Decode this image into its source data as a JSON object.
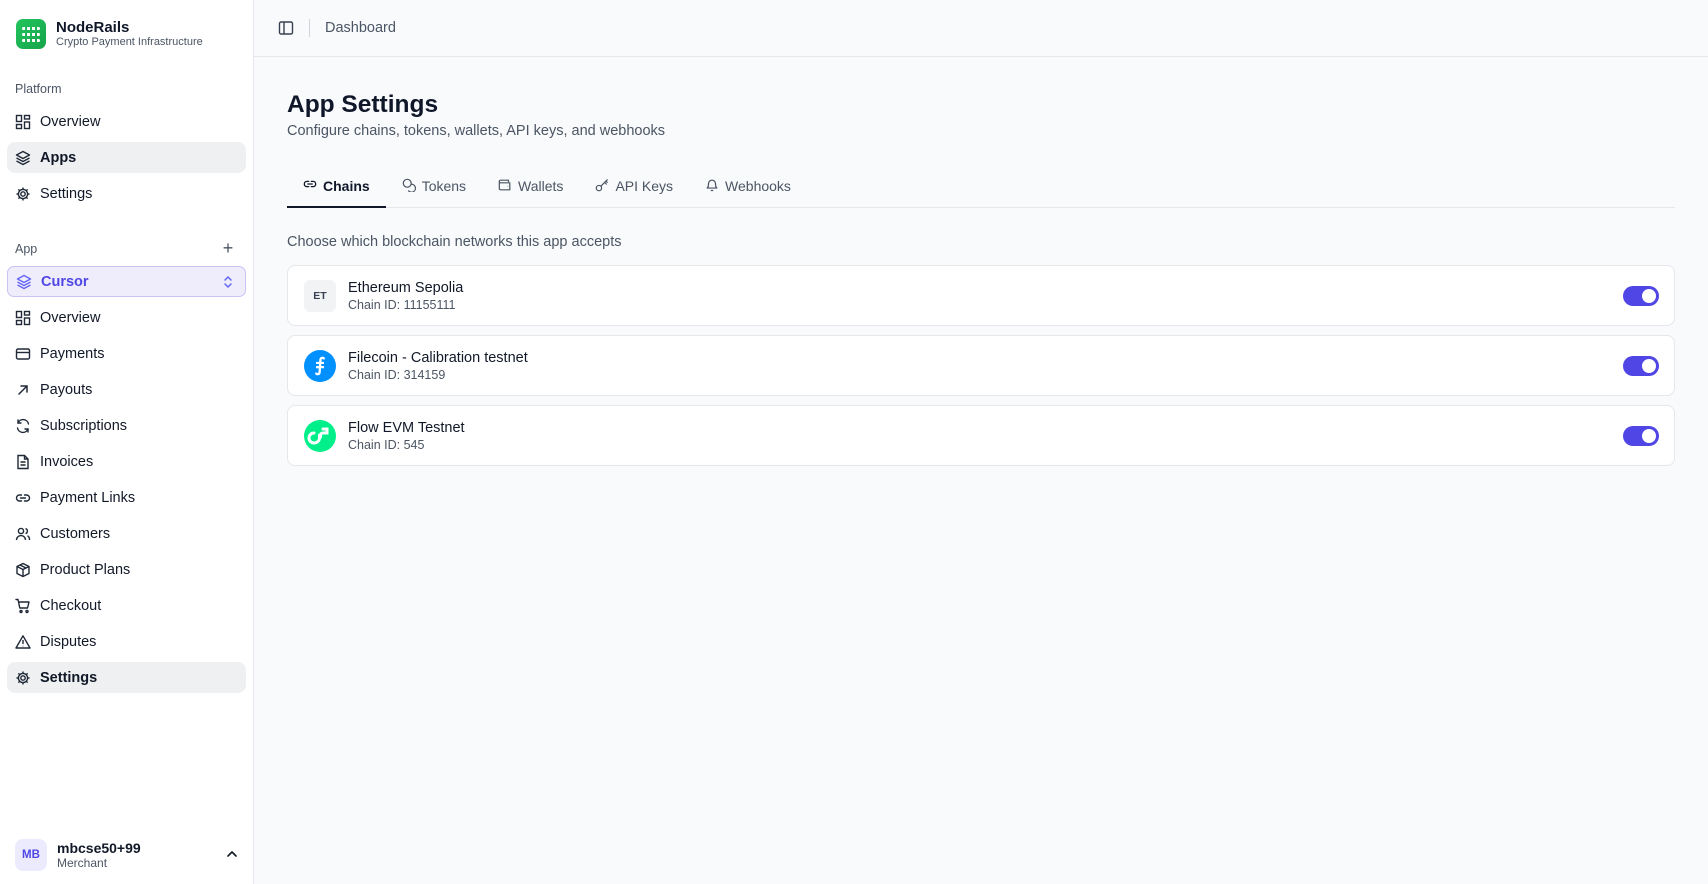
{
  "brand": {
    "name": "NodeRails",
    "tagline": "Crypto Payment Infrastructure"
  },
  "sidebar": {
    "platform_label": "Platform",
    "platform_items": [
      {
        "label": "Overview",
        "icon": "dashboard-icon"
      },
      {
        "label": "Apps",
        "icon": "layers-icon",
        "active": true
      },
      {
        "label": "Settings",
        "icon": "gear-icon"
      }
    ],
    "app_label": "App",
    "add_label": "+",
    "selected_app": "Cursor",
    "app_items": [
      {
        "label": "Overview",
        "icon": "dashboard-icon"
      },
      {
        "label": "Payments",
        "icon": "credit-card-icon"
      },
      {
        "label": "Payouts",
        "icon": "arrow-up-right-icon"
      },
      {
        "label": "Subscriptions",
        "icon": "refresh-icon"
      },
      {
        "label": "Invoices",
        "icon": "document-icon"
      },
      {
        "label": "Payment Links",
        "icon": "link-icon"
      },
      {
        "label": "Customers",
        "icon": "users-icon"
      },
      {
        "label": "Product Plans",
        "icon": "package-icon"
      },
      {
        "label": "Checkout",
        "icon": "cart-icon"
      },
      {
        "label": "Disputes",
        "icon": "warning-icon"
      },
      {
        "label": "Settings",
        "icon": "gear-icon",
        "active": true
      }
    ],
    "user": {
      "initials": "MB",
      "name": "mbcse50+99",
      "role": "Merchant"
    }
  },
  "topbar": {
    "breadcrumb": "Dashboard"
  },
  "page": {
    "title": "App Settings",
    "subtitle": "Configure chains, tokens, wallets, API keys, and webhooks",
    "tabs": [
      {
        "label": "Chains",
        "icon": "link-icon",
        "active": true
      },
      {
        "label": "Tokens",
        "icon": "coins-icon"
      },
      {
        "label": "Wallets",
        "icon": "wallet-icon"
      },
      {
        "label": "API Keys",
        "icon": "key-icon"
      },
      {
        "label": "Webhooks",
        "icon": "bell-icon"
      }
    ],
    "hint": "Choose which blockchain networks this app accepts",
    "chains": [
      {
        "logo_text": "ET",
        "name": "Ethereum Sepolia",
        "chain_id": "Chain ID: 11155111",
        "enabled": true
      },
      {
        "logo_text": "⨎",
        "name": "Filecoin - Calibration testnet",
        "chain_id": "Chain ID: 314159",
        "enabled": true
      },
      {
        "logo_text": "",
        "name": "Flow EVM Testnet",
        "chain_id": "Chain ID: 545",
        "enabled": true
      }
    ]
  },
  "colors": {
    "accent": "#4f46e5",
    "active_bg": "#eef0f2",
    "filecoin": "#0090ff",
    "flow": "#00ef8b"
  }
}
